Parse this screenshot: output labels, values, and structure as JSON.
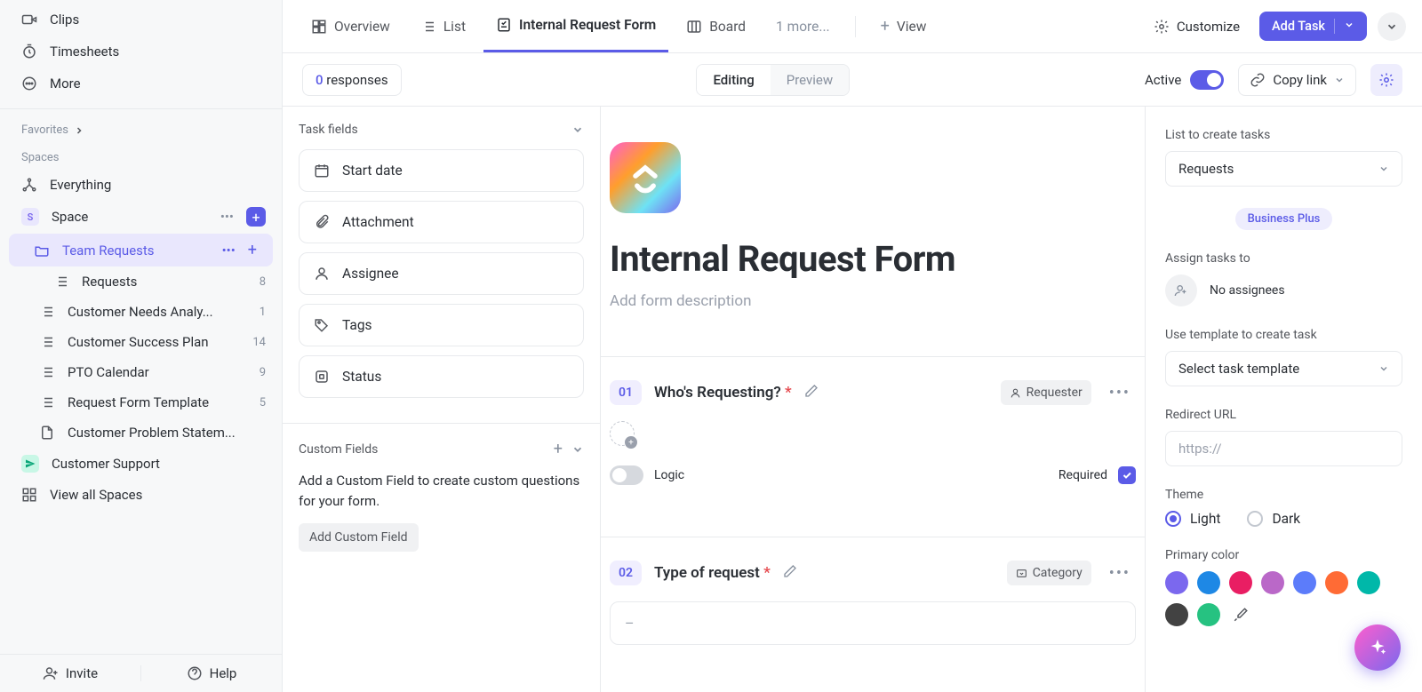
{
  "sidebar": {
    "top": [
      {
        "icon": "video",
        "label": "Clips"
      },
      {
        "icon": "timer",
        "label": "Timesheets"
      },
      {
        "icon": "more",
        "label": "More"
      }
    ],
    "favorites_label": "Favorites",
    "spaces_label": "Spaces",
    "everything_label": "Everything",
    "space": {
      "chip": "S",
      "label": "Space"
    },
    "team_requests": "Team Requests",
    "requests": {
      "label": "Requests",
      "count": "8"
    },
    "lists": [
      {
        "label": "Customer Needs Analy...",
        "count": "1"
      },
      {
        "label": "Customer Success Plan",
        "count": "14"
      },
      {
        "label": "PTO Calendar",
        "count": "9"
      },
      {
        "label": "Request Form Template",
        "count": "5"
      },
      {
        "label": "Customer Problem Statem...",
        "count": ""
      }
    ],
    "customer_support": "Customer Support",
    "view_all": "View all Spaces",
    "invite": "Invite",
    "help": "Help"
  },
  "tabs": {
    "overview": "Overview",
    "list": "List",
    "form": "Internal Request Form",
    "board": "Board",
    "more": "1 more...",
    "view": "View",
    "customize": "Customize",
    "add_task": "Add Task"
  },
  "toolbar": {
    "responses_count": "0",
    "responses_label": "responses",
    "editing": "Editing",
    "preview": "Preview",
    "active": "Active",
    "copy_link": "Copy link"
  },
  "left_panel": {
    "task_fields": "Task fields",
    "fields": [
      {
        "icon": "calendar",
        "label": "Start date"
      },
      {
        "icon": "attachment",
        "label": "Attachment"
      },
      {
        "icon": "person",
        "label": "Assignee"
      },
      {
        "icon": "tag",
        "label": "Tags"
      },
      {
        "icon": "status",
        "label": "Status"
      }
    ],
    "custom_fields": "Custom Fields",
    "cf_hint": "Add a Custom Field to create custom questions for your form.",
    "add_cf": "Add Custom Field"
  },
  "form": {
    "title": "Internal Request Form",
    "desc_placeholder": "Add form description",
    "q1": {
      "num": "01",
      "title": "Who's Requesting?",
      "tag": "Requester",
      "logic": "Logic",
      "required": "Required"
    },
    "q2": {
      "num": "02",
      "title": "Type of request",
      "tag": "Category",
      "placeholder": "–"
    }
  },
  "right_panel": {
    "list_label": "List to create tasks",
    "list_value": "Requests",
    "plan_badge": "Business Plus",
    "assign_label": "Assign tasks to",
    "no_assignees": "No assignees",
    "template_label": "Use template to create task",
    "template_value": "Select task template",
    "redirect_label": "Redirect URL",
    "redirect_placeholder": "https://",
    "theme_label": "Theme",
    "theme_light": "Light",
    "theme_dark": "Dark",
    "primary_label": "Primary color",
    "colors": [
      "#7b68ee",
      "#1e88e5",
      "#e91e63",
      "#ba68c8",
      "#5c7cfa",
      "#ff6b35",
      "#00b8a9",
      "#424242",
      "#26c281"
    ]
  }
}
